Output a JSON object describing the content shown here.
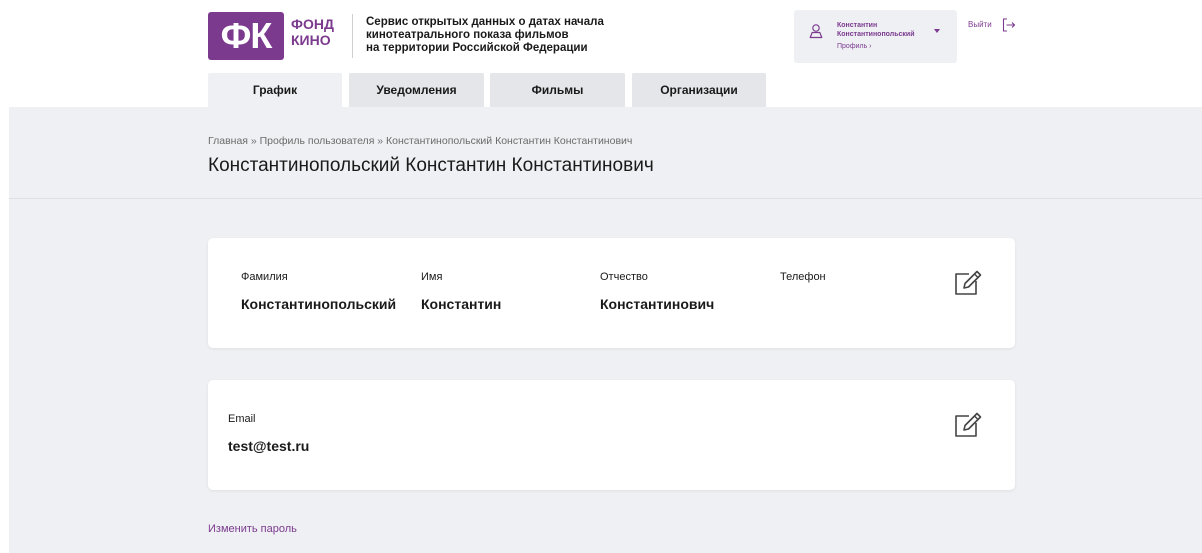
{
  "header": {
    "logo_letters": "ФК",
    "logo_word1": "ФОНД",
    "logo_word2": "КИНО",
    "service_title": [
      "Сервис открытых данных о датах начала",
      "кинотеатрального показа фильмов",
      "на территории Российской Федерации"
    ],
    "user": {
      "first_name": "Константин",
      "last_name": "Константинопольский",
      "profile_link": "Профиль ›"
    },
    "logout_label": "Выйти"
  },
  "tabs": [
    {
      "label": "График",
      "active": true
    },
    {
      "label": "Уведомления",
      "active": false
    },
    {
      "label": "Фильмы",
      "active": false
    },
    {
      "label": "Организации",
      "active": false
    }
  ],
  "breadcrumb": "Главная » Профиль пользователя » Константинопольский Константин Константинович",
  "page_title": "Константинопольский Константин Константинович",
  "personal_card": {
    "fields": [
      {
        "label": "Фамилия",
        "value": "Константинопольский"
      },
      {
        "label": "Имя",
        "value": "Константин"
      },
      {
        "label": "Отчество",
        "value": "Константинович"
      },
      {
        "label": "Телефон",
        "value": ""
      }
    ],
    "edit_icon": "edit-icon"
  },
  "email_card": {
    "label": "Email",
    "value": "test@test.ru",
    "edit_icon": "edit-icon"
  },
  "change_password_label": "Изменить пароль",
  "colors": {
    "brand": "#7b3a8e",
    "background": "#eef0f3",
    "tab_inactive": "#e4e6ea",
    "text": "#1a1a1a"
  }
}
